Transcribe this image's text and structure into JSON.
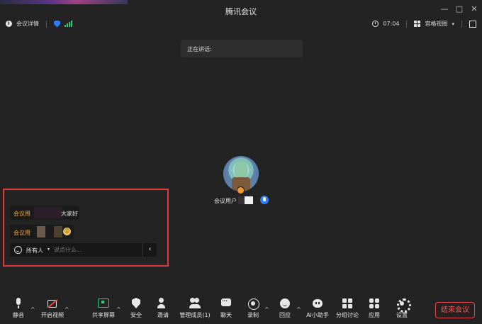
{
  "window": {
    "title": "腾讯会议",
    "controls": {
      "minimize": "—",
      "maximize": "□",
      "close": "✕"
    }
  },
  "infobar": {
    "meeting_details": "会议详情",
    "timer": "07:04",
    "view_mode": "宫格视图",
    "view_caret": "▾"
  },
  "speaking_banner": "正在讲话:",
  "participant": {
    "name": "会议用户"
  },
  "chat": {
    "messages": [
      {
        "sender": "会议用",
        "text": "大家好"
      },
      {
        "sender": "会议用",
        "text": ""
      }
    ],
    "recipient": "所有人",
    "recipient_caret": "▾",
    "placeholder": "说点什么...",
    "collapse": "‹",
    "emoji_badge": "☺"
  },
  "toolbar": {
    "items": [
      {
        "label": "静音",
        "icon": "mic-icon",
        "has_caret": true
      },
      {
        "label": "开启视频",
        "icon": "camera-off-icon",
        "has_caret": true
      },
      {
        "label": "共享屏幕",
        "icon": "share-screen-icon",
        "has_caret": true
      },
      {
        "label": "安全",
        "icon": "shield-icon",
        "has_caret": false
      },
      {
        "label": "邀请",
        "icon": "invite-icon",
        "has_caret": false
      },
      {
        "label": "管理成员(1)",
        "icon": "members-icon",
        "has_caret": false
      },
      {
        "label": "聊天",
        "icon": "chat-icon",
        "has_caret": false
      },
      {
        "label": "录制",
        "icon": "record-icon",
        "has_caret": true
      },
      {
        "label": "回应",
        "icon": "reaction-icon",
        "has_caret": true
      },
      {
        "label": "AI小助手",
        "icon": "ai-assistant-icon",
        "has_caret": false
      },
      {
        "label": "分组讨论",
        "icon": "breakout-icon",
        "has_caret": false
      },
      {
        "label": "应用",
        "icon": "apps-icon",
        "has_caret": false
      },
      {
        "label": "设置",
        "icon": "gear-icon",
        "has_caret": false
      }
    ],
    "caret": "^",
    "end_meeting": "结束会议"
  },
  "colors": {
    "background": "#232323",
    "accent_orange": "#f0a54a",
    "end_red": "#e24b4b",
    "highlight_border": "#e03a3a",
    "blue": "#2f7df6",
    "green": "#2ecc71"
  }
}
